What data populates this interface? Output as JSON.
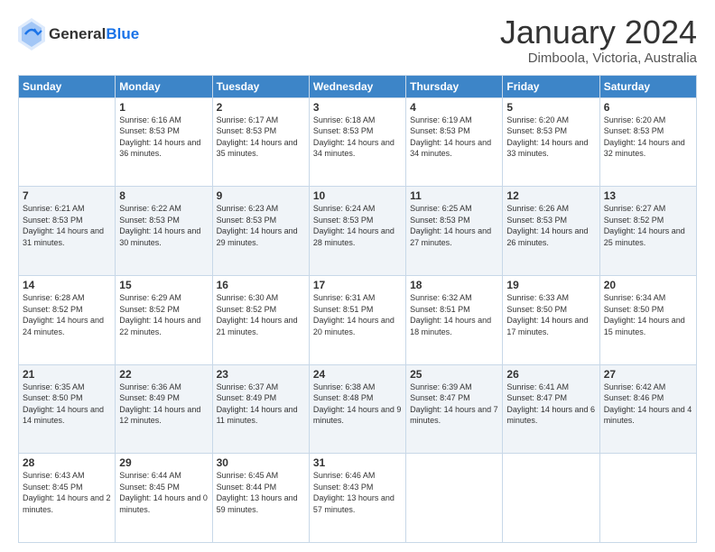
{
  "header": {
    "logo_general": "General",
    "logo_blue": "Blue",
    "month": "January 2024",
    "location": "Dimboola, Victoria, Australia"
  },
  "columns": [
    "Sunday",
    "Monday",
    "Tuesday",
    "Wednesday",
    "Thursday",
    "Friday",
    "Saturday"
  ],
  "weeks": [
    [
      {
        "day": "",
        "sunrise": "",
        "sunset": "",
        "daylight": ""
      },
      {
        "day": "1",
        "sunrise": "Sunrise: 6:16 AM",
        "sunset": "Sunset: 8:53 PM",
        "daylight": "Daylight: 14 hours and 36 minutes."
      },
      {
        "day": "2",
        "sunrise": "Sunrise: 6:17 AM",
        "sunset": "Sunset: 8:53 PM",
        "daylight": "Daylight: 14 hours and 35 minutes."
      },
      {
        "day": "3",
        "sunrise": "Sunrise: 6:18 AM",
        "sunset": "Sunset: 8:53 PM",
        "daylight": "Daylight: 14 hours and 34 minutes."
      },
      {
        "day": "4",
        "sunrise": "Sunrise: 6:19 AM",
        "sunset": "Sunset: 8:53 PM",
        "daylight": "Daylight: 14 hours and 34 minutes."
      },
      {
        "day": "5",
        "sunrise": "Sunrise: 6:20 AM",
        "sunset": "Sunset: 8:53 PM",
        "daylight": "Daylight: 14 hours and 33 minutes."
      },
      {
        "day": "6",
        "sunrise": "Sunrise: 6:20 AM",
        "sunset": "Sunset: 8:53 PM",
        "daylight": "Daylight: 14 hours and 32 minutes."
      }
    ],
    [
      {
        "day": "7",
        "sunrise": "Sunrise: 6:21 AM",
        "sunset": "Sunset: 8:53 PM",
        "daylight": "Daylight: 14 hours and 31 minutes."
      },
      {
        "day": "8",
        "sunrise": "Sunrise: 6:22 AM",
        "sunset": "Sunset: 8:53 PM",
        "daylight": "Daylight: 14 hours and 30 minutes."
      },
      {
        "day": "9",
        "sunrise": "Sunrise: 6:23 AM",
        "sunset": "Sunset: 8:53 PM",
        "daylight": "Daylight: 14 hours and 29 minutes."
      },
      {
        "day": "10",
        "sunrise": "Sunrise: 6:24 AM",
        "sunset": "Sunset: 8:53 PM",
        "daylight": "Daylight: 14 hours and 28 minutes."
      },
      {
        "day": "11",
        "sunrise": "Sunrise: 6:25 AM",
        "sunset": "Sunset: 8:53 PM",
        "daylight": "Daylight: 14 hours and 27 minutes."
      },
      {
        "day": "12",
        "sunrise": "Sunrise: 6:26 AM",
        "sunset": "Sunset: 8:53 PM",
        "daylight": "Daylight: 14 hours and 26 minutes."
      },
      {
        "day": "13",
        "sunrise": "Sunrise: 6:27 AM",
        "sunset": "Sunset: 8:52 PM",
        "daylight": "Daylight: 14 hours and 25 minutes."
      }
    ],
    [
      {
        "day": "14",
        "sunrise": "Sunrise: 6:28 AM",
        "sunset": "Sunset: 8:52 PM",
        "daylight": "Daylight: 14 hours and 24 minutes."
      },
      {
        "day": "15",
        "sunrise": "Sunrise: 6:29 AM",
        "sunset": "Sunset: 8:52 PM",
        "daylight": "Daylight: 14 hours and 22 minutes."
      },
      {
        "day": "16",
        "sunrise": "Sunrise: 6:30 AM",
        "sunset": "Sunset: 8:52 PM",
        "daylight": "Daylight: 14 hours and 21 minutes."
      },
      {
        "day": "17",
        "sunrise": "Sunrise: 6:31 AM",
        "sunset": "Sunset: 8:51 PM",
        "daylight": "Daylight: 14 hours and 20 minutes."
      },
      {
        "day": "18",
        "sunrise": "Sunrise: 6:32 AM",
        "sunset": "Sunset: 8:51 PM",
        "daylight": "Daylight: 14 hours and 18 minutes."
      },
      {
        "day": "19",
        "sunrise": "Sunrise: 6:33 AM",
        "sunset": "Sunset: 8:50 PM",
        "daylight": "Daylight: 14 hours and 17 minutes."
      },
      {
        "day": "20",
        "sunrise": "Sunrise: 6:34 AM",
        "sunset": "Sunset: 8:50 PM",
        "daylight": "Daylight: 14 hours and 15 minutes."
      }
    ],
    [
      {
        "day": "21",
        "sunrise": "Sunrise: 6:35 AM",
        "sunset": "Sunset: 8:50 PM",
        "daylight": "Daylight: 14 hours and 14 minutes."
      },
      {
        "day": "22",
        "sunrise": "Sunrise: 6:36 AM",
        "sunset": "Sunset: 8:49 PM",
        "daylight": "Daylight: 14 hours and 12 minutes."
      },
      {
        "day": "23",
        "sunrise": "Sunrise: 6:37 AM",
        "sunset": "Sunset: 8:49 PM",
        "daylight": "Daylight: 14 hours and 11 minutes."
      },
      {
        "day": "24",
        "sunrise": "Sunrise: 6:38 AM",
        "sunset": "Sunset: 8:48 PM",
        "daylight": "Daylight: 14 hours and 9 minutes."
      },
      {
        "day": "25",
        "sunrise": "Sunrise: 6:39 AM",
        "sunset": "Sunset: 8:47 PM",
        "daylight": "Daylight: 14 hours and 7 minutes."
      },
      {
        "day": "26",
        "sunrise": "Sunrise: 6:41 AM",
        "sunset": "Sunset: 8:47 PM",
        "daylight": "Daylight: 14 hours and 6 minutes."
      },
      {
        "day": "27",
        "sunrise": "Sunrise: 6:42 AM",
        "sunset": "Sunset: 8:46 PM",
        "daylight": "Daylight: 14 hours and 4 minutes."
      }
    ],
    [
      {
        "day": "28",
        "sunrise": "Sunrise: 6:43 AM",
        "sunset": "Sunset: 8:45 PM",
        "daylight": "Daylight: 14 hours and 2 minutes."
      },
      {
        "day": "29",
        "sunrise": "Sunrise: 6:44 AM",
        "sunset": "Sunset: 8:45 PM",
        "daylight": "Daylight: 14 hours and 0 minutes."
      },
      {
        "day": "30",
        "sunrise": "Sunrise: 6:45 AM",
        "sunset": "Sunset: 8:44 PM",
        "daylight": "Daylight: 13 hours and 59 minutes."
      },
      {
        "day": "31",
        "sunrise": "Sunrise: 6:46 AM",
        "sunset": "Sunset: 8:43 PM",
        "daylight": "Daylight: 13 hours and 57 minutes."
      },
      {
        "day": "",
        "sunrise": "",
        "sunset": "",
        "daylight": ""
      },
      {
        "day": "",
        "sunrise": "",
        "sunset": "",
        "daylight": ""
      },
      {
        "day": "",
        "sunrise": "",
        "sunset": "",
        "daylight": ""
      }
    ]
  ]
}
